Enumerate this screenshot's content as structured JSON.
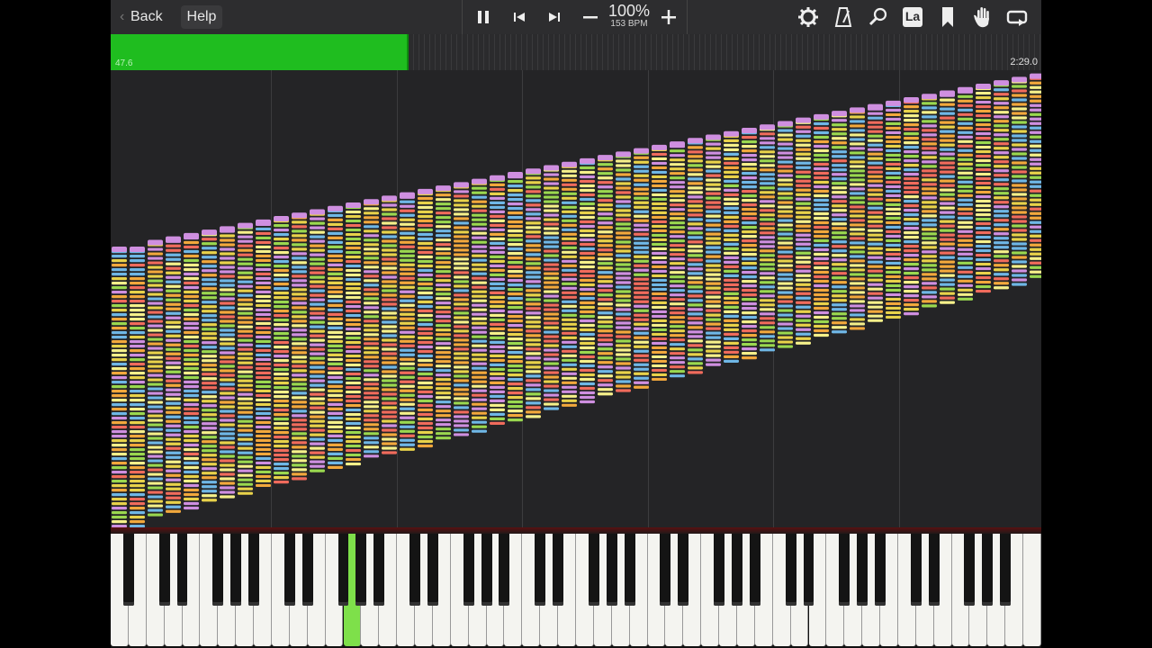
{
  "toolbar": {
    "back_label": "Back",
    "help_label": "Help",
    "tempo_percent": "100%",
    "tempo_bpm": "153 BPM",
    "icons": [
      "pause-icon",
      "skip-back-icon",
      "skip-forward-icon",
      "minus-icon",
      "plus-icon",
      "settings-gear-icon",
      "metronome-icon",
      "search-icon",
      "label-la-icon",
      "bookmark-icon",
      "hand-icon",
      "loop-icon"
    ],
    "la_label": "La"
  },
  "progress": {
    "current_time": "47.6",
    "total_time": "2:29.0",
    "fraction": 0.32,
    "fill_color": "#1fbd1f"
  },
  "keyboard": {
    "pressed_key_color": "#7ee04a"
  },
  "colors": {
    "note_palette": [
      "#e8d24a",
      "#f2a83c",
      "#cf8fe0",
      "#6fb7e6",
      "#9ad84f",
      "#f06b5c",
      "#f5f08a"
    ]
  }
}
